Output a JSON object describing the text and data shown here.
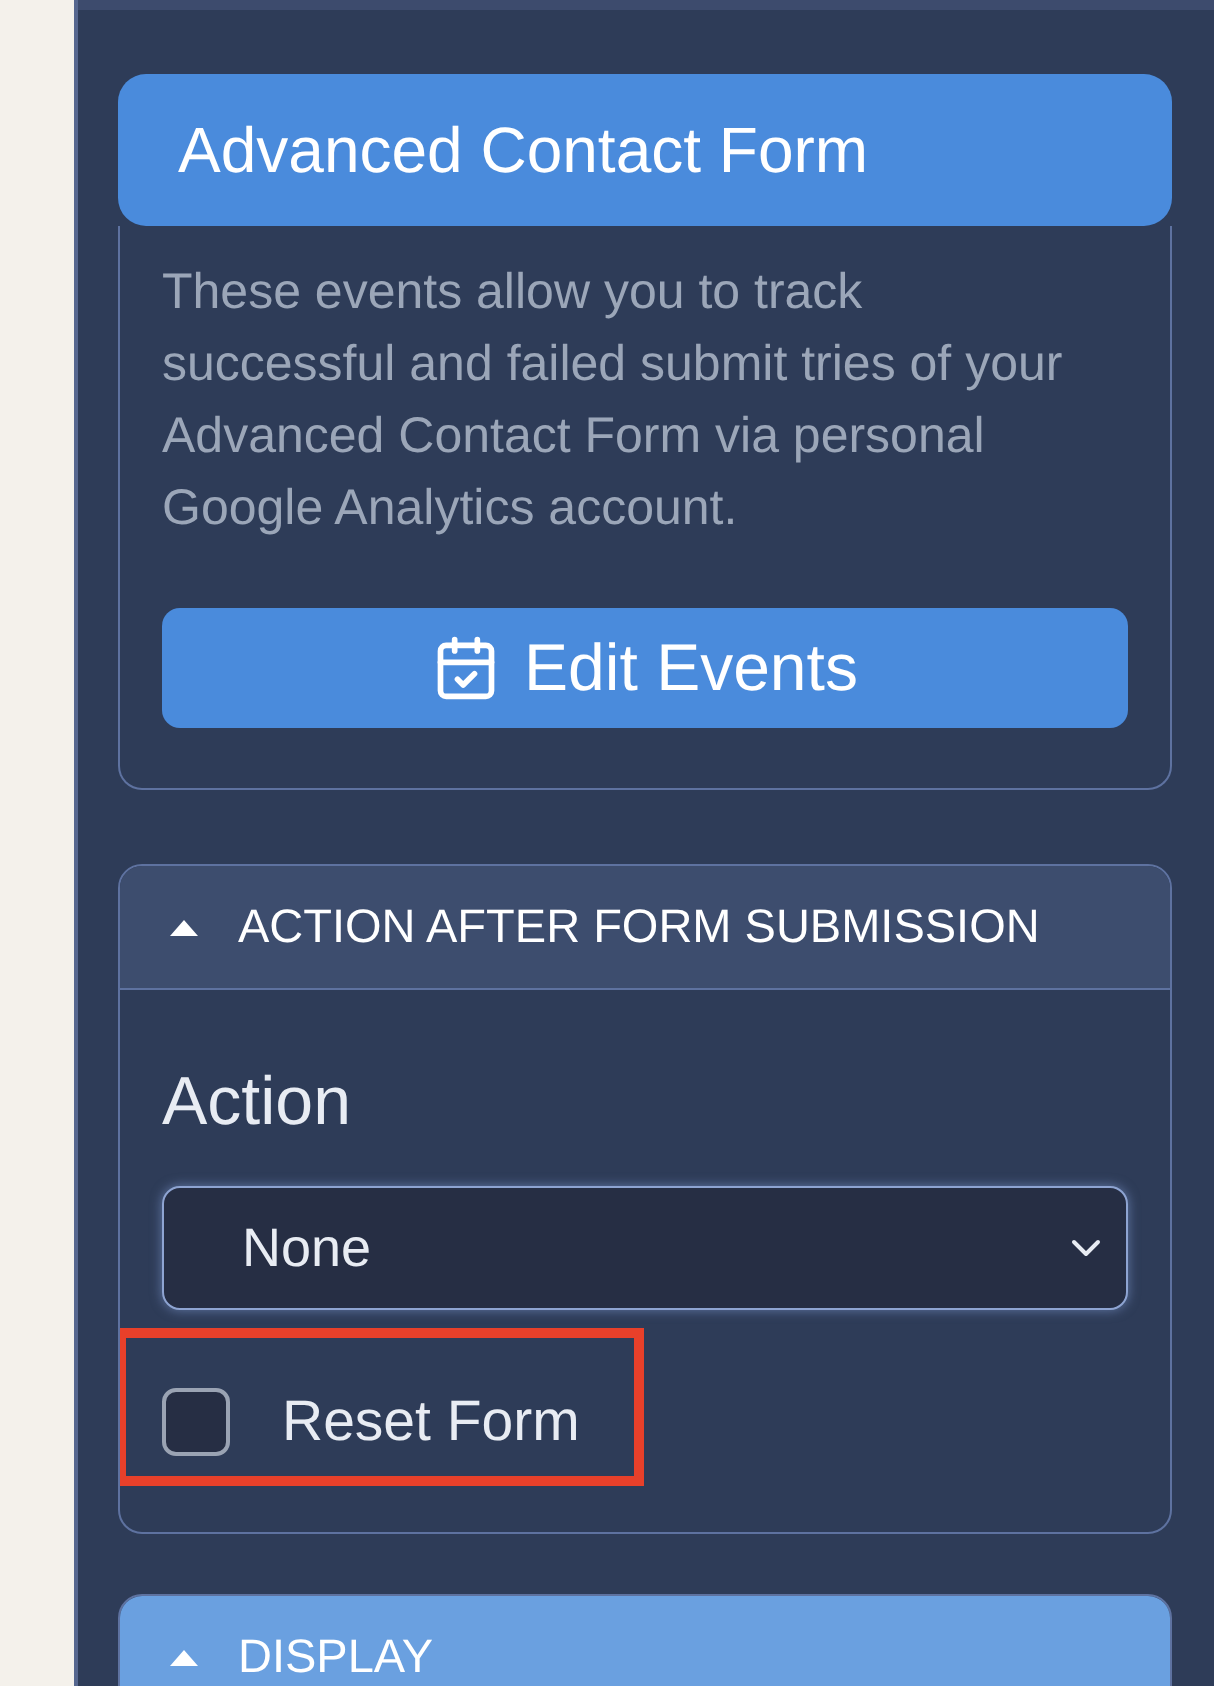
{
  "panel_title": "Advanced Contact Form",
  "events_card": {
    "description": "These events allow you to track successful and failed submit tries of your Advanced Contact Form via personal Google Analytics account.",
    "button": "Edit Events"
  },
  "sections": [
    {
      "title": "ACTION AFTER FORM SUBMISSION",
      "expanded": true,
      "selected": false,
      "action": {
        "label": "Action",
        "value": "None"
      },
      "reset_form": {
        "label": "Reset Form",
        "checked": false,
        "highlighted": true
      }
    },
    {
      "title": "DISPLAY",
      "expanded": true,
      "selected": true
    }
  ]
}
